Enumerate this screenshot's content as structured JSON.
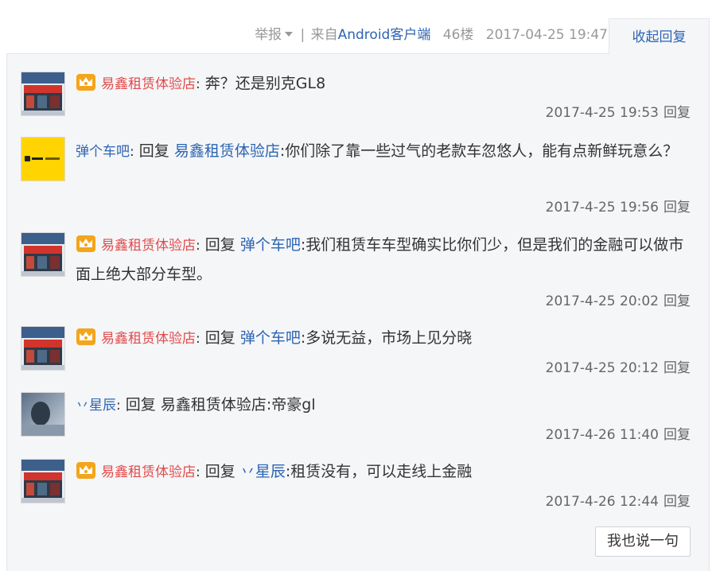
{
  "post_meta": {
    "report": "举报",
    "separator": "|",
    "from_prefix": "来自",
    "client": "Android客户端",
    "floor": "46楼",
    "time": "2017-04-25 19:47"
  },
  "collapse_label": "收起回复",
  "reply_label": "回复",
  "colon": ":",
  "replies": [
    {
      "user": "易鑫租赁体验店",
      "content": "奔？还是别克GL8",
      "time": "2017-4-25 19:53"
    },
    {
      "user": "弹个车吧",
      "reply_word": "回复",
      "target": "易鑫租赁体验店",
      "content": ":你们除了靠一些过气的老款车忽悠人，能有点新鲜玩意么？",
      "time": "2017-4-25 19:56"
    },
    {
      "user": "易鑫租赁体验店",
      "reply_word": "回复",
      "target": "弹个车吧",
      "content": ":我们租赁车车型确实比你们少，但是我们的金融可以做市面上绝大部分车型。",
      "time": "2017-4-25 20:02"
    },
    {
      "user": "易鑫租赁体验店",
      "reply_word": "回复",
      "target": "弹个车吧",
      "content": ":多说无益，市场上见分晓",
      "time": "2017-4-25 20:12"
    },
    {
      "user": "丷星辰",
      "reply_word": "回复",
      "target": "易鑫租赁体验店",
      "content": ":帝豪gl",
      "time": "2017-4-26 11:40"
    },
    {
      "user": "易鑫租赁体验店",
      "reply_word": "回复",
      "target": "丷星辰",
      "content": ":租赁没有，可以走线上金融",
      "time": "2017-4-26 12:44"
    }
  ],
  "say_button": "我也说一句",
  "icons": {
    "crown": "crown-vip-icon",
    "caret": "caret-down-icon"
  },
  "colors": {
    "link_blue": "#2d64b3",
    "vip_red": "#e24b4b",
    "panel_bg": "#f5f6f8",
    "meta_gray": "#999999"
  }
}
